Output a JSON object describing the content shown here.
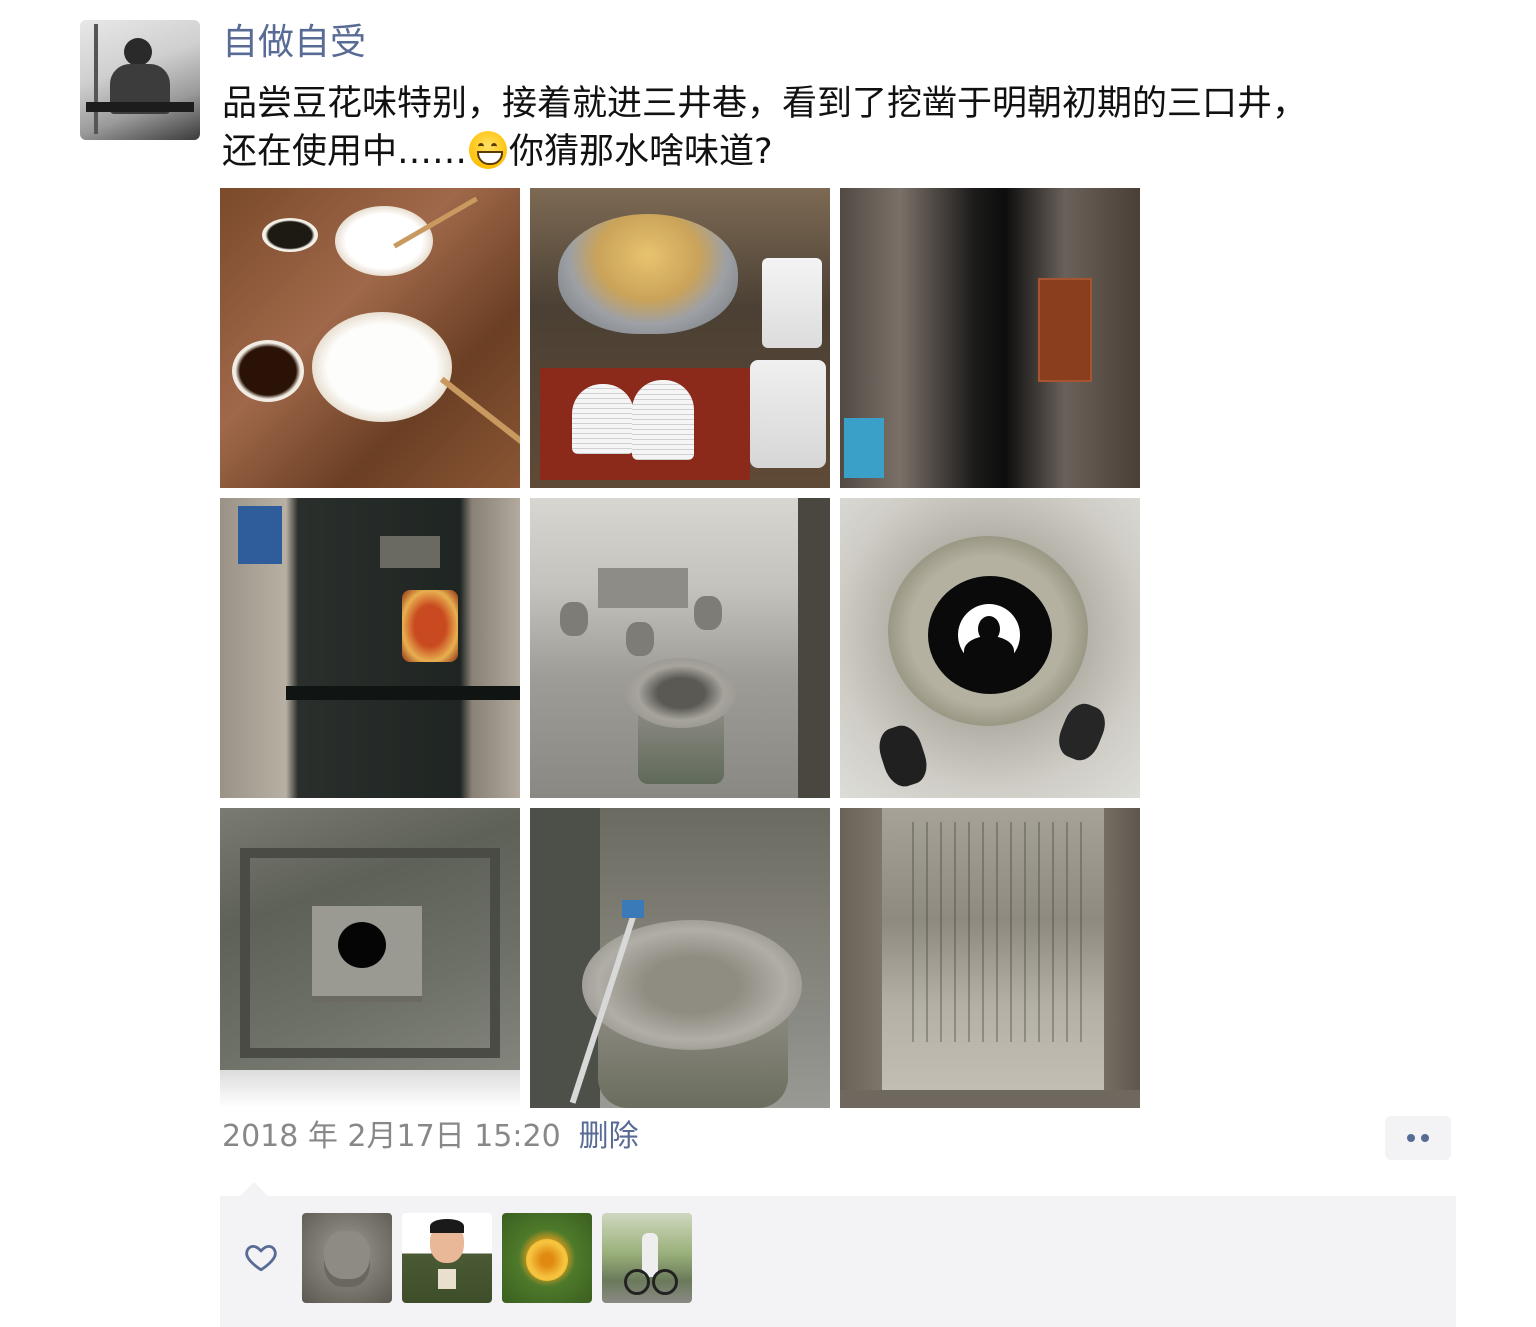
{
  "post": {
    "username": "自做自受",
    "text_line1": "品尝豆花味特别，接着就进三井巷，看到了挖凿于明朝初期的三口井，",
    "text_line2_before_emoji": "还在使用中……",
    "emoji_icon": "grinning-face-icon",
    "text_line2_after_emoji": "你猜那水啥味道?",
    "photos": [
      {
        "icon": "tofu-bowls-photo"
      },
      {
        "icon": "pot-and-plates-photo"
      },
      {
        "icon": "narrow-alley-photo"
      },
      {
        "icon": "old-door-photo"
      },
      {
        "icon": "courtyard-well-photo"
      },
      {
        "icon": "well-reflection-photo"
      },
      {
        "icon": "square-well-photo"
      },
      {
        "icon": "round-well-photo"
      },
      {
        "icon": "stone-tablet-photo"
      }
    ],
    "timestamp": "2018 年 2月17日 15:20",
    "delete_label": "删除",
    "more_icon": "more-dots-icon"
  },
  "likes": {
    "heart_icon": "heart-outline-icon",
    "likers": [
      {
        "icon": "stone-face-avatar"
      },
      {
        "icon": "uniform-man-avatar"
      },
      {
        "icon": "yellow-flower-avatar"
      },
      {
        "icon": "cyclist-avatar"
      }
    ]
  },
  "colors": {
    "link_blue": "#576b95",
    "meta_gray": "#888888",
    "panel_bg": "#f3f3f5"
  }
}
